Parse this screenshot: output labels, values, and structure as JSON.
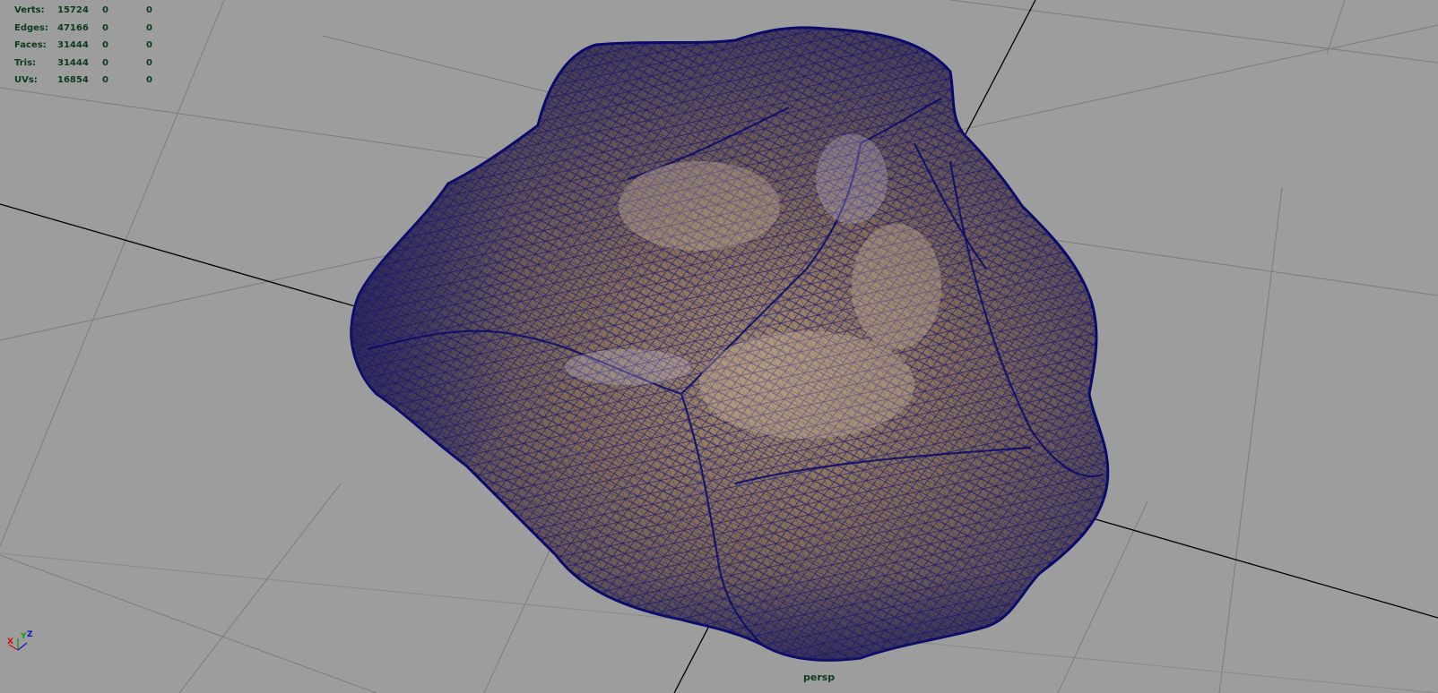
{
  "viewport": {
    "camera_name": "persp",
    "background_color": "#9d9d9d",
    "grid_color": "#808080",
    "axis_line_color": "#000000",
    "wireframe_color": "#0a0a7a",
    "mesh_base_color": "#6e5d4e"
  },
  "hud": {
    "rows": [
      {
        "label": "Verts:",
        "count": "15724",
        "sel1": "0",
        "sel2": "0"
      },
      {
        "label": "Edges:",
        "count": "47166",
        "sel1": "0",
        "sel2": "0"
      },
      {
        "label": "Faces:",
        "count": "31444",
        "sel1": "0",
        "sel2": "0"
      },
      {
        "label": "Tris:",
        "count": "31444",
        "sel1": "0",
        "sel2": "0"
      },
      {
        "label": "UVs:",
        "count": "16854",
        "sel1": "0",
        "sel2": "0"
      }
    ],
    "text_color": "#0c3a1c"
  },
  "axis_gizmo": {
    "x_label": "X",
    "y_label": "Y",
    "z_label": "Z",
    "x_color": "#d01010",
    "y_color": "#10a010",
    "z_color": "#1010d0"
  }
}
